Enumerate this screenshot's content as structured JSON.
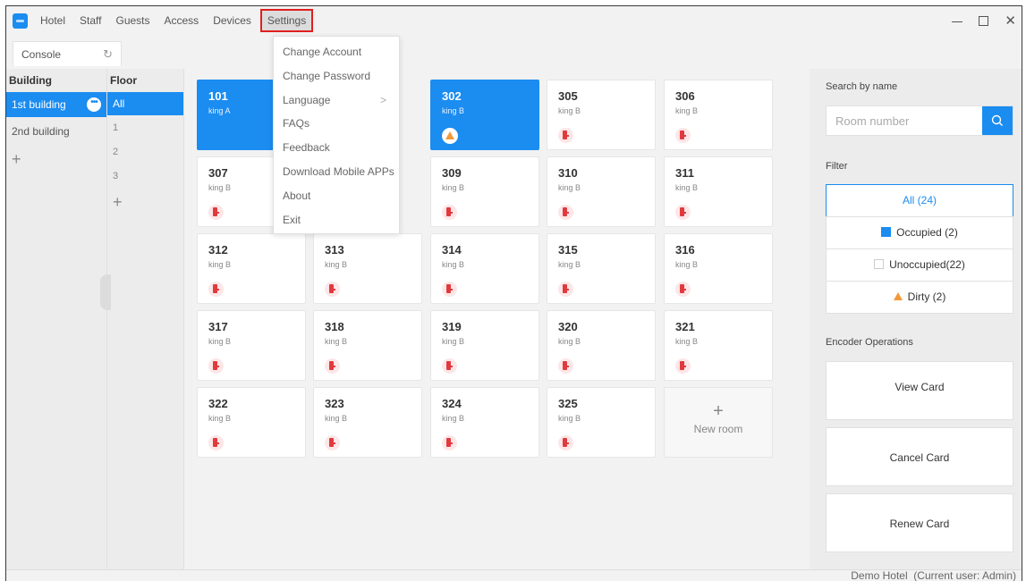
{
  "menubar": {
    "items": [
      "Hotel",
      "Staff",
      "Guests",
      "Access",
      "Devices",
      "Settings"
    ]
  },
  "tabs": {
    "console_label": "Console"
  },
  "building": {
    "header": "Building",
    "items": [
      "1st building",
      "2nd building"
    ],
    "add": "+"
  },
  "floor": {
    "header": "Floor",
    "items": [
      "All",
      "1",
      "2",
      "3"
    ],
    "add": "+"
  },
  "rooms": [
    {
      "num": "101",
      "type": "king A",
      "status": "selected"
    },
    {
      "num": "302",
      "type": "king B",
      "status": "selected-dirty"
    },
    {
      "num": "305",
      "type": "king B",
      "status": "locked"
    },
    {
      "num": "306",
      "type": "king B",
      "status": "locked"
    },
    {
      "num": "307",
      "type": "king B",
      "status": "locked"
    },
    {
      "num": "309",
      "type": "king B",
      "status": "locked"
    },
    {
      "num": "310",
      "type": "king B",
      "status": "locked"
    },
    {
      "num": "311",
      "type": "king B",
      "status": "locked"
    },
    {
      "num": "312",
      "type": "king B",
      "status": "locked"
    },
    {
      "num": "313",
      "type": "king B",
      "status": "locked"
    },
    {
      "num": "314",
      "type": "king B",
      "status": "locked"
    },
    {
      "num": "315",
      "type": "king B",
      "status": "locked"
    },
    {
      "num": "316",
      "type": "king B",
      "status": "locked"
    },
    {
      "num": "317",
      "type": "king B",
      "status": "locked"
    },
    {
      "num": "318",
      "type": "king B",
      "status": "locked"
    },
    {
      "num": "319",
      "type": "king B",
      "status": "locked"
    },
    {
      "num": "320",
      "type": "king B",
      "status": "locked"
    },
    {
      "num": "321",
      "type": "king B",
      "status": "locked"
    },
    {
      "num": "322",
      "type": "king B",
      "status": "locked"
    },
    {
      "num": "323",
      "type": "king B",
      "status": "locked"
    },
    {
      "num": "324",
      "type": "king B",
      "status": "locked"
    },
    {
      "num": "325",
      "type": "king B",
      "status": "locked"
    }
  ],
  "new_room": {
    "plus": "+",
    "label": "New room"
  },
  "settings_menu": {
    "items": [
      "Change Account",
      "Change Password",
      "Language",
      "FAQs",
      "Feedback",
      "Download Mobile APPs",
      "About",
      "Exit"
    ],
    "arrow": ">"
  },
  "right_panel": {
    "search_label": "Search by name",
    "search_placeholder": "Room number",
    "filter_label": "Filter",
    "filters": [
      "All (24)",
      "Occupied (2)",
      "Unoccupied(22)",
      "Dirty (2)"
    ],
    "encoder_label": "Encoder Operations",
    "encoder_buttons": [
      "View Card",
      "Cancel Card",
      "Renew Card"
    ]
  },
  "status": {
    "text": "Demo Hotel  (Current user: Admin)"
  },
  "colors": {
    "accent": "#1b8cf0",
    "highlight_border": "#e0201f",
    "lock": "#e03a3e",
    "dirty": "#f29a3a"
  }
}
